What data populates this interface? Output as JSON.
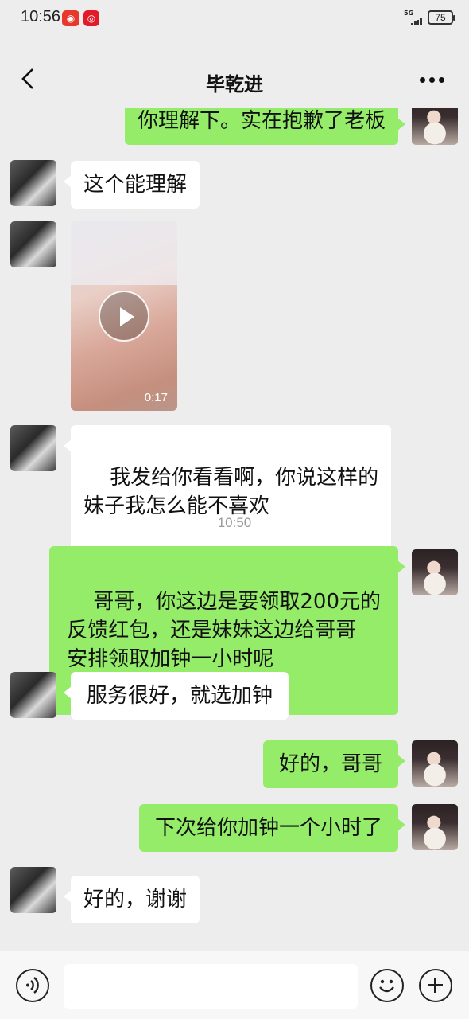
{
  "status_bar": {
    "time": "10:56",
    "network": "5G",
    "battery": "75",
    "app_icons": [
      "weibo-icon",
      "netease-music-icon"
    ]
  },
  "header": {
    "title": "毕乾进",
    "back_icon": "chevron-left-icon",
    "more_icon": "more-dots-icon"
  },
  "messages": [
    {
      "side": "out",
      "text": "你理解下。实在抱歉了老板"
    },
    {
      "side": "in",
      "text": "这个能理解"
    },
    {
      "side": "in",
      "type": "video",
      "duration": "0:17"
    },
    {
      "side": "in",
      "text": "我发给你看看啊，你说这样的\n妹子我怎么能不喜欢"
    },
    {
      "type": "time",
      "text": "10:50"
    },
    {
      "side": "out",
      "text": "哥哥，你这边是要领取200元的\n反馈红包，还是妹妹这边给哥哥\n安排领取加钟一小时呢"
    },
    {
      "side": "in",
      "text": "服务很好，就选加钟"
    },
    {
      "side": "out",
      "text": "好的，哥哥"
    },
    {
      "side": "out",
      "text": "下次给你加钟一个小时了"
    },
    {
      "side": "in",
      "text": "好的，谢谢"
    }
  ],
  "input_bar": {
    "voice_icon": "voice-icon",
    "emoji_icon": "emoji-icon",
    "plus_icon": "plus-icon",
    "input_value": ""
  },
  "colors": {
    "background": "#ededed",
    "outgoing_bubble": "#95ec69",
    "incoming_bubble": "#ffffff"
  }
}
